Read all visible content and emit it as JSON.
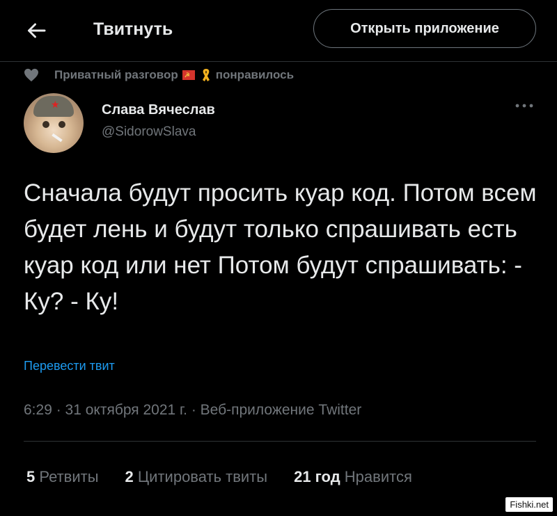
{
  "header": {
    "title": "Твитнуть",
    "open_app_label": "Открыть приложение"
  },
  "context": {
    "chat_name": "Приватный разговор",
    "liked_text": "понравилось"
  },
  "author": {
    "name": "Слава Вячеслав",
    "handle": "@SidorowSlava"
  },
  "tweet": {
    "text": "Сначала будут просить куар код. Потом всем будет лень и будут только спрашивать есть куар код или нет Потом будут спрашивать: - Ку? - Ку!",
    "translate_label": "Перевести твит",
    "meta": "6:29 · 31 октября 2021 г. · Веб-приложение Twitter"
  },
  "stats": [
    {
      "count": "5",
      "label": "Ретвиты"
    },
    {
      "count": "2",
      "label": "Цитировать твиты"
    },
    {
      "count": "21 год",
      "label": "Нравится"
    }
  ],
  "watermark": "Fishki.net",
  "colors": {
    "background": "#000000",
    "text_primary": "#e7e9ea",
    "text_secondary": "#71767b",
    "accent_blue": "#1d9bf0"
  }
}
